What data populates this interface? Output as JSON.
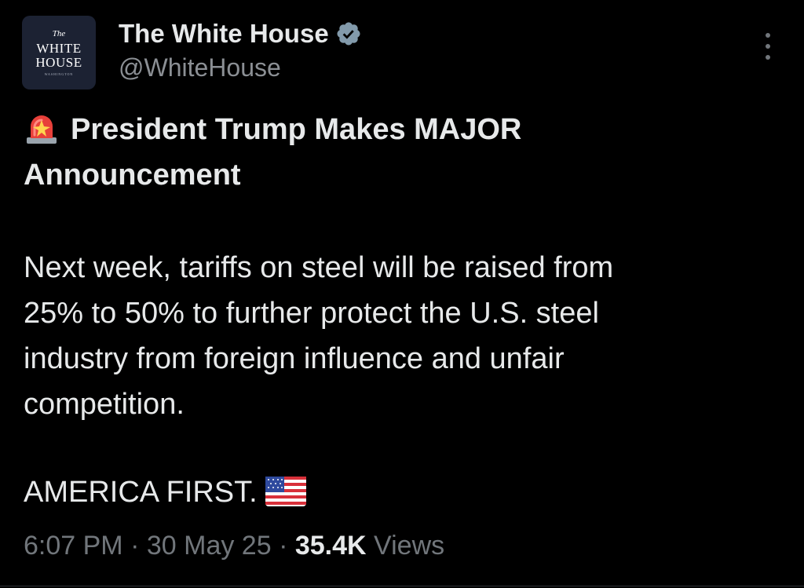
{
  "account": {
    "display_name": "The White House",
    "handle": "@WhiteHouse",
    "avatar_lines": [
      "The",
      "WHITE",
      "HOUSE",
      "WASHINGTON"
    ]
  },
  "tweet": {
    "headline_icon": "police-light-icon",
    "headline": "President Trump Makes MAJOR",
    "headline_line2": "Announcement",
    "body_lines": [
      "Next week, tariffs on steel will be raised from",
      "25% to 50% to further protect the U.S. steel",
      "industry from foreign influence and unfair",
      "competition."
    ],
    "closing": "AMERICA FIRST.",
    "closing_icon": "us-flag-icon"
  },
  "meta": {
    "time": "6:07 PM",
    "separator": "·",
    "date": "30 May 25",
    "views_count": "35.4K",
    "views_label": "Views"
  },
  "colors": {
    "background": "#000000",
    "primary_text": "#e7e9ea",
    "secondary_text": "#71767b",
    "verified_badge": "#829aab"
  }
}
